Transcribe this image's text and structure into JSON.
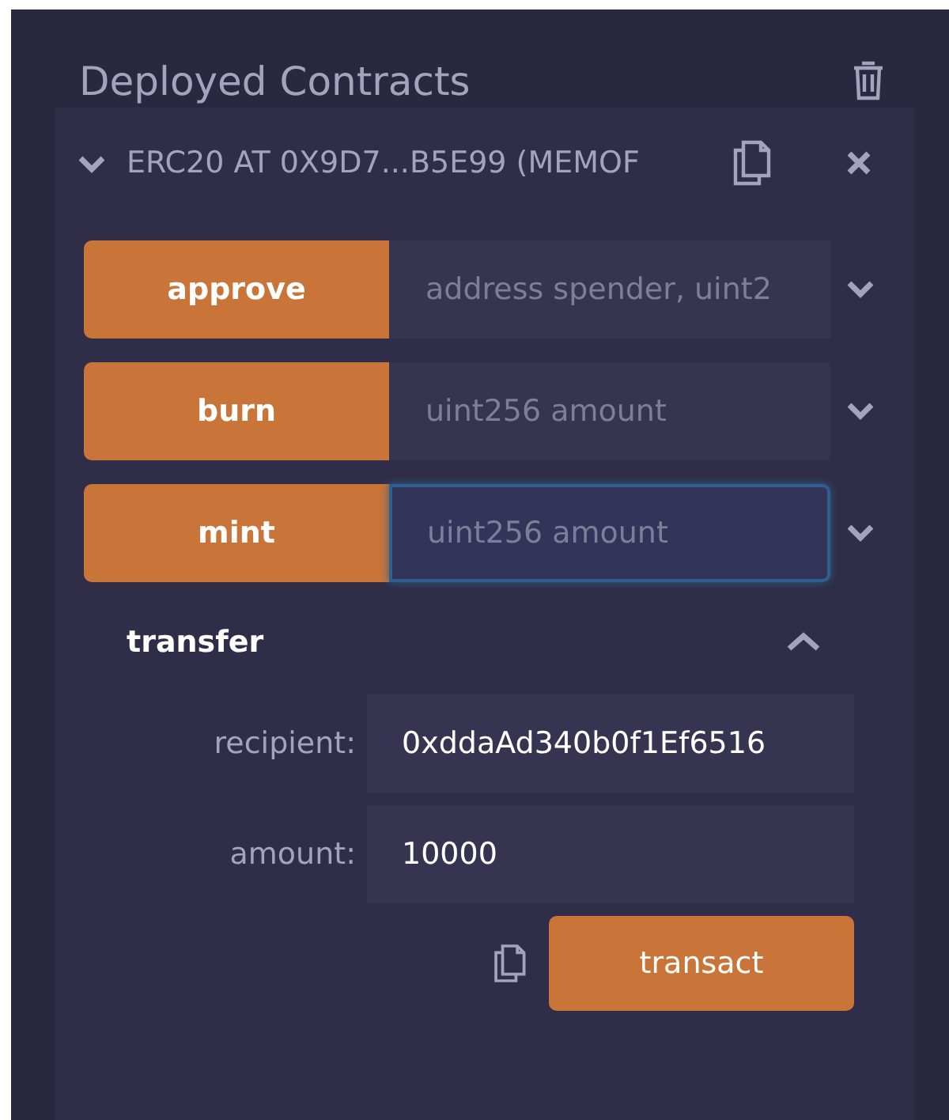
{
  "section": {
    "title": "Deployed Contracts"
  },
  "contract": {
    "title": "ERC20 AT 0X9D7...B5E99 (MEMOF",
    "expanded": true
  },
  "functions": [
    {
      "kind": "single",
      "name": "approve",
      "placeholder": "address spender, uint2",
      "focused": false
    },
    {
      "kind": "single",
      "name": "burn",
      "placeholder": "uint256 amount",
      "focused": false
    },
    {
      "kind": "single",
      "name": "mint",
      "placeholder": "uint256 amount",
      "focused": true
    },
    {
      "kind": "expanded",
      "name": "transfer",
      "params": [
        {
          "label": "recipient:",
          "value": "0xddaAd340b0f1Ef6516"
        },
        {
          "label": "amount:",
          "value": "10000"
        }
      ],
      "action": "transact"
    }
  ]
}
